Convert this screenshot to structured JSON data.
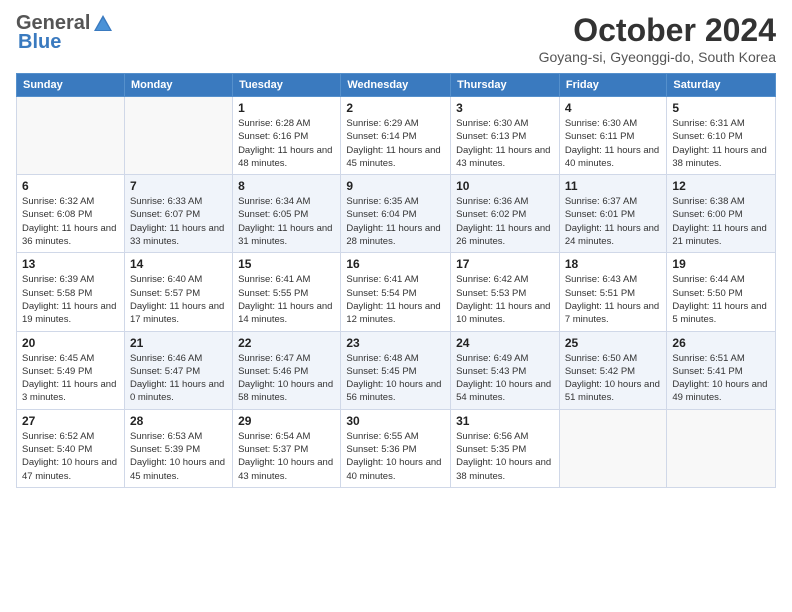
{
  "logo": {
    "general": "General",
    "blue": "Blue"
  },
  "header": {
    "title": "October 2024",
    "location": "Goyang-si, Gyeonggi-do, South Korea"
  },
  "weekdays": [
    "Sunday",
    "Monday",
    "Tuesday",
    "Wednesday",
    "Thursday",
    "Friday",
    "Saturday"
  ],
  "weeks": [
    [
      {
        "day": "",
        "info": ""
      },
      {
        "day": "",
        "info": ""
      },
      {
        "day": "1",
        "info": "Sunrise: 6:28 AM\nSunset: 6:16 PM\nDaylight: 11 hours and 48 minutes."
      },
      {
        "day": "2",
        "info": "Sunrise: 6:29 AM\nSunset: 6:14 PM\nDaylight: 11 hours and 45 minutes."
      },
      {
        "day": "3",
        "info": "Sunrise: 6:30 AM\nSunset: 6:13 PM\nDaylight: 11 hours and 43 minutes."
      },
      {
        "day": "4",
        "info": "Sunrise: 6:30 AM\nSunset: 6:11 PM\nDaylight: 11 hours and 40 minutes."
      },
      {
        "day": "5",
        "info": "Sunrise: 6:31 AM\nSunset: 6:10 PM\nDaylight: 11 hours and 38 minutes."
      }
    ],
    [
      {
        "day": "6",
        "info": "Sunrise: 6:32 AM\nSunset: 6:08 PM\nDaylight: 11 hours and 36 minutes."
      },
      {
        "day": "7",
        "info": "Sunrise: 6:33 AM\nSunset: 6:07 PM\nDaylight: 11 hours and 33 minutes."
      },
      {
        "day": "8",
        "info": "Sunrise: 6:34 AM\nSunset: 6:05 PM\nDaylight: 11 hours and 31 minutes."
      },
      {
        "day": "9",
        "info": "Sunrise: 6:35 AM\nSunset: 6:04 PM\nDaylight: 11 hours and 28 minutes."
      },
      {
        "day": "10",
        "info": "Sunrise: 6:36 AM\nSunset: 6:02 PM\nDaylight: 11 hours and 26 minutes."
      },
      {
        "day": "11",
        "info": "Sunrise: 6:37 AM\nSunset: 6:01 PM\nDaylight: 11 hours and 24 minutes."
      },
      {
        "day": "12",
        "info": "Sunrise: 6:38 AM\nSunset: 6:00 PM\nDaylight: 11 hours and 21 minutes."
      }
    ],
    [
      {
        "day": "13",
        "info": "Sunrise: 6:39 AM\nSunset: 5:58 PM\nDaylight: 11 hours and 19 minutes."
      },
      {
        "day": "14",
        "info": "Sunrise: 6:40 AM\nSunset: 5:57 PM\nDaylight: 11 hours and 17 minutes."
      },
      {
        "day": "15",
        "info": "Sunrise: 6:41 AM\nSunset: 5:55 PM\nDaylight: 11 hours and 14 minutes."
      },
      {
        "day": "16",
        "info": "Sunrise: 6:41 AM\nSunset: 5:54 PM\nDaylight: 11 hours and 12 minutes."
      },
      {
        "day": "17",
        "info": "Sunrise: 6:42 AM\nSunset: 5:53 PM\nDaylight: 11 hours and 10 minutes."
      },
      {
        "day": "18",
        "info": "Sunrise: 6:43 AM\nSunset: 5:51 PM\nDaylight: 11 hours and 7 minutes."
      },
      {
        "day": "19",
        "info": "Sunrise: 6:44 AM\nSunset: 5:50 PM\nDaylight: 11 hours and 5 minutes."
      }
    ],
    [
      {
        "day": "20",
        "info": "Sunrise: 6:45 AM\nSunset: 5:49 PM\nDaylight: 11 hours and 3 minutes."
      },
      {
        "day": "21",
        "info": "Sunrise: 6:46 AM\nSunset: 5:47 PM\nDaylight: 11 hours and 0 minutes."
      },
      {
        "day": "22",
        "info": "Sunrise: 6:47 AM\nSunset: 5:46 PM\nDaylight: 10 hours and 58 minutes."
      },
      {
        "day": "23",
        "info": "Sunrise: 6:48 AM\nSunset: 5:45 PM\nDaylight: 10 hours and 56 minutes."
      },
      {
        "day": "24",
        "info": "Sunrise: 6:49 AM\nSunset: 5:43 PM\nDaylight: 10 hours and 54 minutes."
      },
      {
        "day": "25",
        "info": "Sunrise: 6:50 AM\nSunset: 5:42 PM\nDaylight: 10 hours and 51 minutes."
      },
      {
        "day": "26",
        "info": "Sunrise: 6:51 AM\nSunset: 5:41 PM\nDaylight: 10 hours and 49 minutes."
      }
    ],
    [
      {
        "day": "27",
        "info": "Sunrise: 6:52 AM\nSunset: 5:40 PM\nDaylight: 10 hours and 47 minutes."
      },
      {
        "day": "28",
        "info": "Sunrise: 6:53 AM\nSunset: 5:39 PM\nDaylight: 10 hours and 45 minutes."
      },
      {
        "day": "29",
        "info": "Sunrise: 6:54 AM\nSunset: 5:37 PM\nDaylight: 10 hours and 43 minutes."
      },
      {
        "day": "30",
        "info": "Sunrise: 6:55 AM\nSunset: 5:36 PM\nDaylight: 10 hours and 40 minutes."
      },
      {
        "day": "31",
        "info": "Sunrise: 6:56 AM\nSunset: 5:35 PM\nDaylight: 10 hours and 38 minutes."
      },
      {
        "day": "",
        "info": ""
      },
      {
        "day": "",
        "info": ""
      }
    ]
  ]
}
